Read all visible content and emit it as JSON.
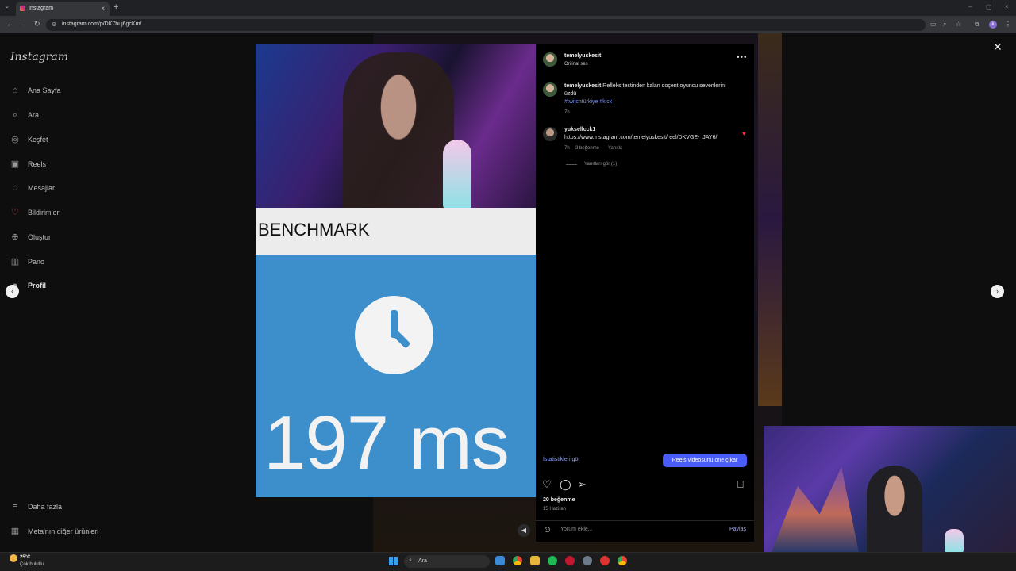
{
  "browser": {
    "tab_title": "Instagram",
    "tab_close": "×",
    "new_tab": "+",
    "tab_menu": "⌄",
    "url": "instagram.com/p/DK7buj6gcKm/",
    "window_controls": [
      "–",
      "▢",
      "×"
    ],
    "profile_initial": "k"
  },
  "sidebar": {
    "logo": "Instagram",
    "items": [
      {
        "label": "Ana Sayfa",
        "icon": "home-icon",
        "glyph": "⌂"
      },
      {
        "label": "Ara",
        "icon": "search-icon",
        "glyph": "⌕"
      },
      {
        "label": "Keşfet",
        "icon": "compass-icon",
        "glyph": "◎"
      },
      {
        "label": "Reels",
        "icon": "reels-icon",
        "glyph": "▣"
      },
      {
        "label": "Mesajlar",
        "icon": "messenger-icon",
        "glyph": "◌"
      },
      {
        "label": "Bildirimler",
        "icon": "heart-icon",
        "glyph": "♡"
      },
      {
        "label": "Oluştur",
        "icon": "plus-icon",
        "glyph": "⊕"
      },
      {
        "label": "Pano",
        "icon": "dashboard-icon",
        "glyph": "▥"
      },
      {
        "label": "Profil",
        "icon": "avatar-icon",
        "glyph": "●"
      }
    ],
    "more_label": "Daha fazla",
    "meta_label": "Meta'nın diğer ürünleri"
  },
  "post": {
    "media_text": "BENCHMARK",
    "result_value": "197 ms",
    "author": "temelyuskesit",
    "audio": "Orijinal ses",
    "more_icon": "•••",
    "caption": {
      "user": "temelyuskesit",
      "text": "Refleks testinden kalan doçent oyuncu sevenlerini üzdü",
      "tags": "#twitchtürkiye #kick",
      "time": "7h"
    },
    "comment": {
      "user": "yuksellcck1",
      "text": "https://www.instagram.com/temelyuskesit/reel/DKVGE-_JAY6/",
      "time": "7h",
      "likes": "3 beğenme",
      "reply": "Yanıtla",
      "view_replies": "Yanıtları gör (1)"
    },
    "stats_link": "İstatistikleri gör",
    "boost_button": "Reels videosunu öne çıkar",
    "likes_count": "20 beğenme",
    "date": "15 Haziran",
    "comment_placeholder": "Yorum ekle...",
    "share_label": "Paylaş"
  },
  "taskbar": {
    "temperature": "25°C",
    "weather": "Çok bulutlu",
    "search": "Ara"
  }
}
